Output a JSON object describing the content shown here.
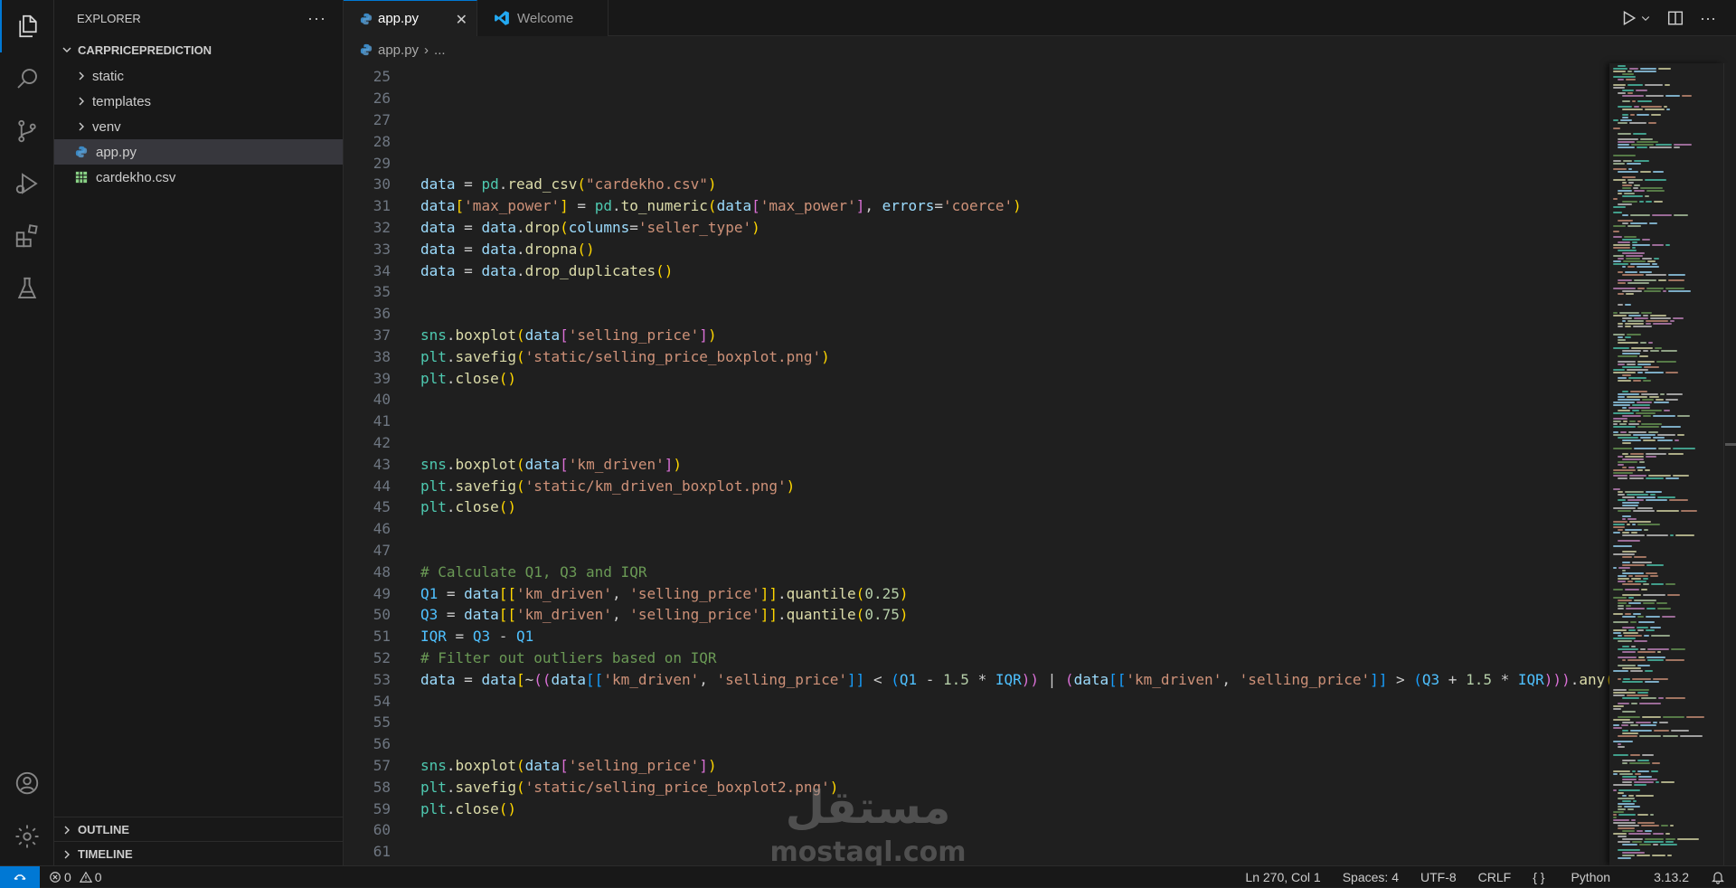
{
  "sidebar": {
    "title": "EXPLORER",
    "more_label": "···",
    "project": "CARPRICEPREDICTION",
    "items": [
      {
        "label": "static",
        "kind": "folder"
      },
      {
        "label": "templates",
        "kind": "folder"
      },
      {
        "label": "venv",
        "kind": "folder"
      },
      {
        "label": "app.py",
        "kind": "python"
      },
      {
        "label": "cardekho.csv",
        "kind": "csv"
      }
    ],
    "outline": "OUTLINE",
    "timeline": "TIMELINE"
  },
  "tabs": [
    {
      "label": "app.py",
      "active": true,
      "close": "✕"
    },
    {
      "label": "Welcome",
      "active": false
    }
  ],
  "breadcrumb": {
    "file": "app.py",
    "sep": "›",
    "more": "..."
  },
  "code_lines": [
    {
      "n": "25",
      "tokens": []
    },
    {
      "n": "26",
      "tokens": []
    },
    {
      "n": "27",
      "tokens": []
    },
    {
      "n": "28",
      "tokens": []
    },
    {
      "n": "29",
      "tokens": []
    },
    {
      "n": "30",
      "tokens": [
        [
          "data",
          "v"
        ],
        [
          " = ",
          "p"
        ],
        [
          "pd",
          "c"
        ],
        [
          ".",
          "p"
        ],
        [
          "read_csv",
          "f"
        ],
        [
          "(",
          "b1"
        ],
        [
          "\"cardekho.csv\"",
          "s"
        ],
        [
          ")",
          "b1"
        ]
      ]
    },
    {
      "n": "31",
      "tokens": [
        [
          "data",
          "v"
        ],
        [
          "[",
          "b1"
        ],
        [
          "'max_power'",
          "s"
        ],
        [
          "]",
          "b1"
        ],
        [
          " = ",
          "p"
        ],
        [
          "pd",
          "c"
        ],
        [
          ".",
          "p"
        ],
        [
          "to_numeric",
          "f"
        ],
        [
          "(",
          "b1"
        ],
        [
          "data",
          "v"
        ],
        [
          "[",
          "b2"
        ],
        [
          "'max_power'",
          "s"
        ],
        [
          "]",
          "b2"
        ],
        [
          ", ",
          "p"
        ],
        [
          "errors",
          "v"
        ],
        [
          "=",
          "p"
        ],
        [
          "'coerce'",
          "s"
        ],
        [
          ")",
          "b1"
        ]
      ]
    },
    {
      "n": "32",
      "tokens": [
        [
          "data",
          "v"
        ],
        [
          " = ",
          "p"
        ],
        [
          "data",
          "v"
        ],
        [
          ".",
          "p"
        ],
        [
          "drop",
          "f"
        ],
        [
          "(",
          "b1"
        ],
        [
          "columns",
          "v"
        ],
        [
          "=",
          "p"
        ],
        [
          "'seller_type'",
          "s"
        ],
        [
          ")",
          "b1"
        ]
      ]
    },
    {
      "n": "33",
      "tokens": [
        [
          "data",
          "v"
        ],
        [
          " = ",
          "p"
        ],
        [
          "data",
          "v"
        ],
        [
          ".",
          "p"
        ],
        [
          "dropna",
          "f"
        ],
        [
          "()",
          "b1"
        ]
      ]
    },
    {
      "n": "34",
      "tokens": [
        [
          "data",
          "v"
        ],
        [
          " = ",
          "p"
        ],
        [
          "data",
          "v"
        ],
        [
          ".",
          "p"
        ],
        [
          "drop_duplicates",
          "f"
        ],
        [
          "()",
          "b1"
        ]
      ]
    },
    {
      "n": "35",
      "tokens": []
    },
    {
      "n": "36",
      "tokens": []
    },
    {
      "n": "37",
      "tokens": [
        [
          "sns",
          "c"
        ],
        [
          ".",
          "p"
        ],
        [
          "boxplot",
          "f"
        ],
        [
          "(",
          "b1"
        ],
        [
          "data",
          "v"
        ],
        [
          "[",
          "b2"
        ],
        [
          "'selling_price'",
          "s"
        ],
        [
          "]",
          "b2"
        ],
        [
          ")",
          "b1"
        ]
      ]
    },
    {
      "n": "38",
      "tokens": [
        [
          "plt",
          "c"
        ],
        [
          ".",
          "p"
        ],
        [
          "savefig",
          "f"
        ],
        [
          "(",
          "b1"
        ],
        [
          "'static/selling_price_boxplot.png'",
          "s"
        ],
        [
          ")",
          "b1"
        ]
      ]
    },
    {
      "n": "39",
      "tokens": [
        [
          "plt",
          "c"
        ],
        [
          ".",
          "p"
        ],
        [
          "close",
          "f"
        ],
        [
          "()",
          "b1"
        ]
      ]
    },
    {
      "n": "40",
      "tokens": []
    },
    {
      "n": "41",
      "tokens": []
    },
    {
      "n": "42",
      "tokens": []
    },
    {
      "n": "43",
      "tokens": [
        [
          "sns",
          "c"
        ],
        [
          ".",
          "p"
        ],
        [
          "boxplot",
          "f"
        ],
        [
          "(",
          "b1"
        ],
        [
          "data",
          "v"
        ],
        [
          "[",
          "b2"
        ],
        [
          "'km_driven'",
          "s"
        ],
        [
          "]",
          "b2"
        ],
        [
          ")",
          "b1"
        ]
      ]
    },
    {
      "n": "44",
      "tokens": [
        [
          "plt",
          "c"
        ],
        [
          ".",
          "p"
        ],
        [
          "savefig",
          "f"
        ],
        [
          "(",
          "b1"
        ],
        [
          "'static/km_driven_boxplot.png'",
          "s"
        ],
        [
          ")",
          "b1"
        ]
      ]
    },
    {
      "n": "45",
      "tokens": [
        [
          "plt",
          "c"
        ],
        [
          ".",
          "p"
        ],
        [
          "close",
          "f"
        ],
        [
          "()",
          "b1"
        ]
      ]
    },
    {
      "n": "46",
      "tokens": []
    },
    {
      "n": "47",
      "tokens": []
    },
    {
      "n": "48",
      "tokens": [
        [
          "# Calculate Q1, Q3 and IQR",
          "cm"
        ]
      ]
    },
    {
      "n": "49",
      "tokens": [
        [
          "Q1",
          "k"
        ],
        [
          " = ",
          "p"
        ],
        [
          "data",
          "v"
        ],
        [
          "[[",
          "b1"
        ],
        [
          "'km_driven'",
          "s"
        ],
        [
          ", ",
          "p"
        ],
        [
          "'selling_price'",
          "s"
        ],
        [
          "]]",
          "b1"
        ],
        [
          ".",
          "p"
        ],
        [
          "quantile",
          "f"
        ],
        [
          "(",
          "b1"
        ],
        [
          "0.25",
          "n"
        ],
        [
          ")",
          "b1"
        ]
      ]
    },
    {
      "n": "50",
      "tokens": [
        [
          "Q3",
          "k"
        ],
        [
          " = ",
          "p"
        ],
        [
          "data",
          "v"
        ],
        [
          "[[",
          "b1"
        ],
        [
          "'km_driven'",
          "s"
        ],
        [
          ", ",
          "p"
        ],
        [
          "'selling_price'",
          "s"
        ],
        [
          "]]",
          "b1"
        ],
        [
          ".",
          "p"
        ],
        [
          "quantile",
          "f"
        ],
        [
          "(",
          "b1"
        ],
        [
          "0.75",
          "n"
        ],
        [
          ")",
          "b1"
        ]
      ]
    },
    {
      "n": "51",
      "tokens": [
        [
          "IQR",
          "k"
        ],
        [
          " = ",
          "p"
        ],
        [
          "Q3",
          "k"
        ],
        [
          " - ",
          "p"
        ],
        [
          "Q1",
          "k"
        ]
      ]
    },
    {
      "n": "52",
      "tokens": [
        [
          "# Filter out outliers based on IQR",
          "cm"
        ]
      ]
    },
    {
      "n": "53",
      "tokens": [
        [
          "data",
          "v"
        ],
        [
          " = ",
          "p"
        ],
        [
          "data",
          "v"
        ],
        [
          "[",
          "b1"
        ],
        [
          "~",
          "p"
        ],
        [
          "((",
          "b2"
        ],
        [
          "data",
          "v"
        ],
        [
          "[[",
          "b3"
        ],
        [
          "'km_driven'",
          "s"
        ],
        [
          ", ",
          "p"
        ],
        [
          "'selling_price'",
          "s"
        ],
        [
          "]]",
          "b3"
        ],
        [
          " < ",
          "p"
        ],
        [
          "(",
          "b3"
        ],
        [
          "Q1",
          "k"
        ],
        [
          " - ",
          "p"
        ],
        [
          "1.5",
          "n"
        ],
        [
          " * ",
          "p"
        ],
        [
          "IQR",
          "k"
        ],
        [
          "))",
          "b2"
        ],
        [
          " | ",
          "p"
        ],
        [
          "(",
          "b2"
        ],
        [
          "data",
          "v"
        ],
        [
          "[[",
          "b3"
        ],
        [
          "'km_driven'",
          "s"
        ],
        [
          ", ",
          "p"
        ],
        [
          "'selling_price'",
          "s"
        ],
        [
          "]]",
          "b3"
        ],
        [
          " > ",
          "p"
        ],
        [
          "(",
          "b3"
        ],
        [
          "Q3",
          "k"
        ],
        [
          " + ",
          "p"
        ],
        [
          "1.5",
          "n"
        ],
        [
          " * ",
          "p"
        ],
        [
          "IQR",
          "k"
        ],
        [
          ")))",
          "b2"
        ],
        [
          ".",
          "p"
        ],
        [
          "any",
          "f"
        ],
        [
          "(",
          "b1"
        ]
      ]
    },
    {
      "n": "54",
      "tokens": []
    },
    {
      "n": "55",
      "tokens": []
    },
    {
      "n": "56",
      "tokens": []
    },
    {
      "n": "57",
      "tokens": [
        [
          "sns",
          "c"
        ],
        [
          ".",
          "p"
        ],
        [
          "boxplot",
          "f"
        ],
        [
          "(",
          "b1"
        ],
        [
          "data",
          "v"
        ],
        [
          "[",
          "b2"
        ],
        [
          "'selling_price'",
          "s"
        ],
        [
          "]",
          "b2"
        ],
        [
          ")",
          "b1"
        ]
      ]
    },
    {
      "n": "58",
      "tokens": [
        [
          "plt",
          "c"
        ],
        [
          ".",
          "p"
        ],
        [
          "savefig",
          "f"
        ],
        [
          "(",
          "b1"
        ],
        [
          "'static/selling_price_boxplot2.png'",
          "s"
        ],
        [
          ")",
          "b1"
        ]
      ]
    },
    {
      "n": "59",
      "tokens": [
        [
          "plt",
          "c"
        ],
        [
          ".",
          "p"
        ],
        [
          "close",
          "f"
        ],
        [
          "()",
          "b1"
        ]
      ]
    },
    {
      "n": "60",
      "tokens": []
    },
    {
      "n": "61",
      "tokens": []
    }
  ],
  "token_colors": {
    "v": "#9cdcfe",
    "p": "#cccccc",
    "c": "#4ec9b0",
    "f": "#dcdcaa",
    "s": "#ce9178",
    "n": "#b5cea8",
    "k": "#4fc1ff",
    "cm": "#6a9955",
    "b1": "#ffd700",
    "b2": "#da70d6",
    "b3": "#179fff"
  },
  "status": {
    "errors": "0",
    "warnings": "0",
    "position": "Ln 270, Col 1",
    "spaces": "Spaces: 4",
    "encoding": "UTF-8",
    "eol": "CRLF",
    "language": "Python",
    "version": "3.13.2"
  },
  "watermark": {
    "arabic": "مستقل",
    "latin": "mostaql.com"
  },
  "colors": {
    "accent": "#0078d4",
    "bg": "#1f1f1f",
    "panel": "#181818"
  }
}
